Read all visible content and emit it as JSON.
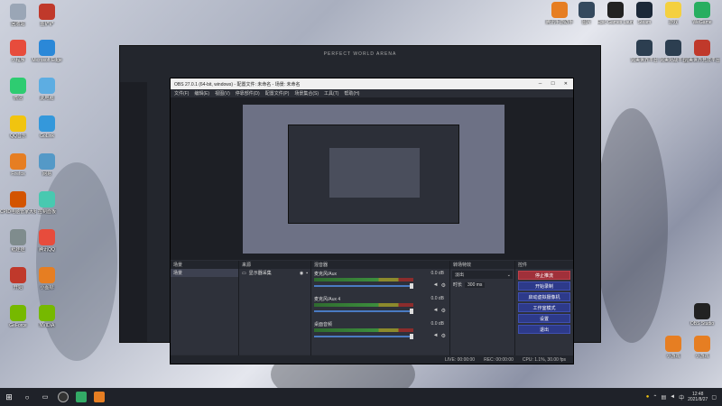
{
  "desktop": {
    "left_icons": [
      {
        "label": "回收站",
        "color": "#9aa6b6"
      },
      {
        "label": "金铲铲",
        "color": "#c0392b"
      },
      {
        "label": "小程序",
        "color": "#e74c3c"
      },
      {
        "label": "Microsoft Edge",
        "color": "#2b88d8"
      },
      {
        "label": "微信",
        "color": "#2ecc71"
      },
      {
        "label": "此电脑",
        "color": "#5dade2"
      },
      {
        "label": "QQ音乐",
        "color": "#f1c40f"
      },
      {
        "label": "GoLink",
        "color": "#3498db"
      },
      {
        "label": "Firefox",
        "color": "#e67e22"
      },
      {
        "label": "网易",
        "color": "#5499c7"
      },
      {
        "label": "CPID电脑管家大赛",
        "color": "#d35400"
      },
      {
        "label": "控制面板",
        "color": "#48c9b0"
      },
      {
        "label": "纸娃娃",
        "color": "#7f8c8d"
      },
      {
        "label": "腾讯QQ",
        "color": "#e74c3c"
      },
      {
        "label": "开始",
        "color": "#c0392b"
      },
      {
        "label": "小图标",
        "color": "#e67e22"
      },
      {
        "label": "GeForce",
        "color": "#76b900"
      },
      {
        "label": "NVIDIA",
        "color": "#76b900"
      }
    ],
    "right_icons": [
      {
        "label": "腾讯手游助手",
        "color": "#e67e22"
      },
      {
        "label": "图片",
        "color": "#34495e"
      },
      {
        "label": "Epic Games Launcher",
        "color": "#222"
      },
      {
        "label": "Steam",
        "color": "#1b2838"
      },
      {
        "label": "游戏",
        "color": "#f4d03f"
      },
      {
        "label": "WeGame",
        "color": "#27ae60"
      },
      {
        "label": "完美世界平台",
        "color": "#2c3e50"
      },
      {
        "label": "完美对战平台",
        "color": "#2c3e50"
      },
      {
        "label": "完美世界竞技平台",
        "color": "#c0392b"
      },
      {
        "label": "OBS Studio",
        "color": "#222"
      },
      {
        "label": "小游戏",
        "color": "#e67e22"
      },
      {
        "label": "小游戏",
        "color": "#e67e22"
      }
    ]
  },
  "game": {
    "title": "PERFECT WORLD ARENA"
  },
  "obs": {
    "title": "OBS 27.0.1 (64-bit, windows) - 配置文件: 未命名 - 场景: 未命名",
    "menu": [
      "文件(F)",
      "编辑(E)",
      "视图(V)",
      "停靠部件(D)",
      "配置文件(P)",
      "场景集合(S)",
      "工具(T)",
      "帮助(H)"
    ],
    "panel_bar": {
      "no_source": "未选择源",
      "props": "属性",
      "filters": "滤镜"
    },
    "docks": {
      "scenes": {
        "header": "场景",
        "items": [
          "场景"
        ]
      },
      "sources": {
        "header": "来源",
        "items": [
          "显示器采集"
        ]
      },
      "mixer": {
        "header": "混音器",
        "channels": [
          {
            "name": "麦克风/Aux",
            "db": "0.0 dB"
          },
          {
            "name": "麦克风/Aux 4",
            "db": "0.0 dB"
          },
          {
            "name": "桌面音频",
            "db": "0.0 dB"
          }
        ]
      },
      "transitions": {
        "header": "转场特效",
        "type": "淡出",
        "duration_label": "时长",
        "duration": "300 ms"
      },
      "controls": {
        "header": "控件",
        "buttons": [
          "停止推流",
          "开始录制",
          "启动虚拟摄像机",
          "工作室模式",
          "设置",
          "退出"
        ]
      }
    },
    "status": {
      "live": "LIVE: 00:00:00",
      "rec": "REC: 00:00:00",
      "cpu": "CPU: 1.1%, 30.00 fps"
    }
  },
  "taskbar": {
    "start_icon": "windows-icon",
    "time": "12:48",
    "date": "2021/8/27"
  }
}
